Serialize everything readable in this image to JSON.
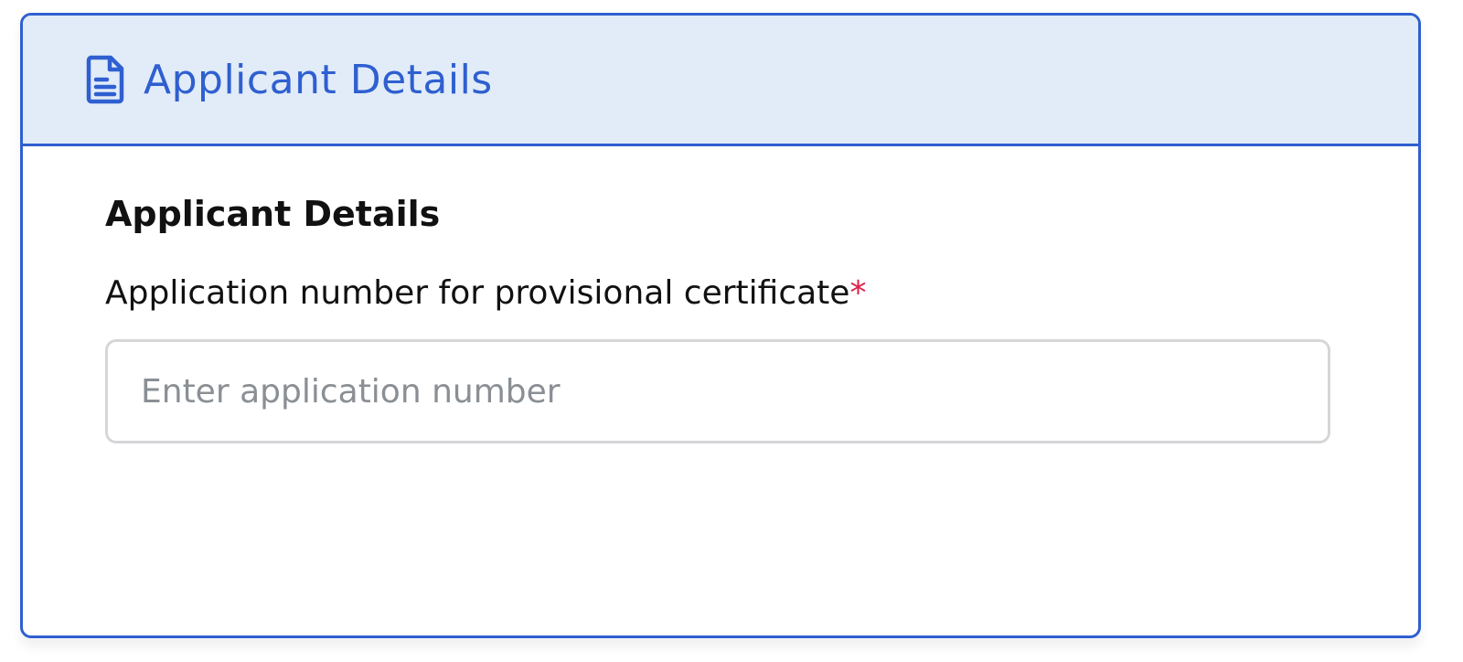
{
  "card": {
    "header": {
      "title": "Applicant Details",
      "icon": "document-icon"
    },
    "section": {
      "title": "Applicant Details",
      "field": {
        "label": "Application number for provisional certificate",
        "required_marker": "*",
        "placeholder": "Enter application number",
        "value": ""
      }
    }
  },
  "colors": {
    "accent": "#2f5fd0",
    "header_bg": "#e1ecf8",
    "required": "#e11d48",
    "input_border": "#d4d6d8",
    "placeholder": "#8a8f94"
  }
}
